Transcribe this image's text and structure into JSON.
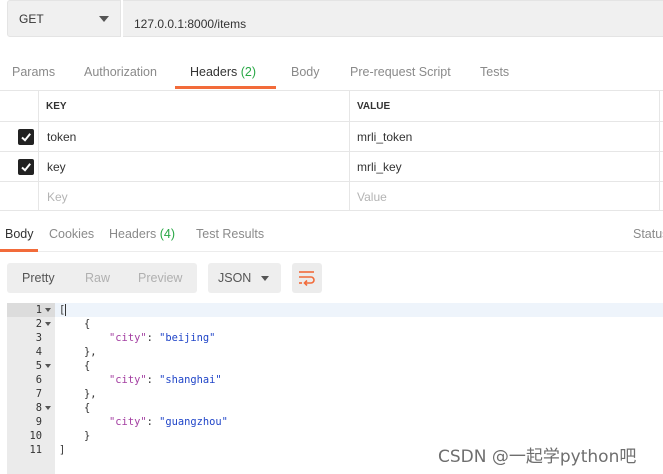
{
  "request": {
    "method": "GET",
    "url": "127.0.0.1:8000/items"
  },
  "request_tabs": [
    {
      "label": "Params",
      "count": ""
    },
    {
      "label": "Authorization",
      "count": ""
    },
    {
      "label": "Headers",
      "count": "(2)"
    },
    {
      "label": "Body",
      "count": ""
    },
    {
      "label": "Pre-request Script",
      "count": ""
    },
    {
      "label": "Tests",
      "count": ""
    }
  ],
  "headers_table": {
    "key_header": "KEY",
    "value_header": "VALUE",
    "rows": [
      {
        "checked": true,
        "key": "token",
        "value": "mrli_token"
      },
      {
        "checked": true,
        "key": "key",
        "value": "mrli_key"
      }
    ],
    "placeholder_key": "Key",
    "placeholder_value": "Value"
  },
  "response_tabs": [
    {
      "label": "Body",
      "count": ""
    },
    {
      "label": "Cookies",
      "count": ""
    },
    {
      "label": "Headers",
      "count": "(4)"
    },
    {
      "label": "Test Results",
      "count": ""
    }
  ],
  "status_label": "Status",
  "view_modes": [
    "Pretty",
    "Raw",
    "Preview"
  ],
  "format": "JSON",
  "wrap_icon": "wrap-lines-icon",
  "code_lines": [
    {
      "n": "1",
      "fold": true,
      "parts": [
        {
          "t": "["
        }
      ]
    },
    {
      "n": "2",
      "fold": true,
      "parts": [
        {
          "t": "    {"
        }
      ]
    },
    {
      "n": "3",
      "fold": false,
      "parts": [
        {
          "t": "        "
        },
        {
          "t": "\"city\"",
          "c": "k"
        },
        {
          "t": ": "
        },
        {
          "t": "\"beijing\"",
          "c": "s"
        }
      ]
    },
    {
      "n": "4",
      "fold": false,
      "parts": [
        {
          "t": "    },"
        }
      ]
    },
    {
      "n": "5",
      "fold": true,
      "parts": [
        {
          "t": "    {"
        }
      ]
    },
    {
      "n": "6",
      "fold": false,
      "parts": [
        {
          "t": "        "
        },
        {
          "t": "\"city\"",
          "c": "k"
        },
        {
          "t": ": "
        },
        {
          "t": "\"shanghai\"",
          "c": "s"
        }
      ]
    },
    {
      "n": "7",
      "fold": false,
      "parts": [
        {
          "t": "    },"
        }
      ]
    },
    {
      "n": "8",
      "fold": true,
      "parts": [
        {
          "t": "    {"
        }
      ]
    },
    {
      "n": "9",
      "fold": false,
      "parts": [
        {
          "t": "        "
        },
        {
          "t": "\"city\"",
          "c": "k"
        },
        {
          "t": ": "
        },
        {
          "t": "\"guangzhou\"",
          "c": "s"
        }
      ]
    },
    {
      "n": "10",
      "fold": false,
      "parts": [
        {
          "t": "    }"
        }
      ]
    },
    {
      "n": "11",
      "fold": false,
      "parts": [
        {
          "t": "]"
        }
      ]
    }
  ],
  "watermark": "CSDN @一起学python吧",
  "colors": {
    "accent": "#f26b3a",
    "count_green": "#28a745",
    "json_key": "#a33ea1",
    "json_string": "#2045c8"
  }
}
